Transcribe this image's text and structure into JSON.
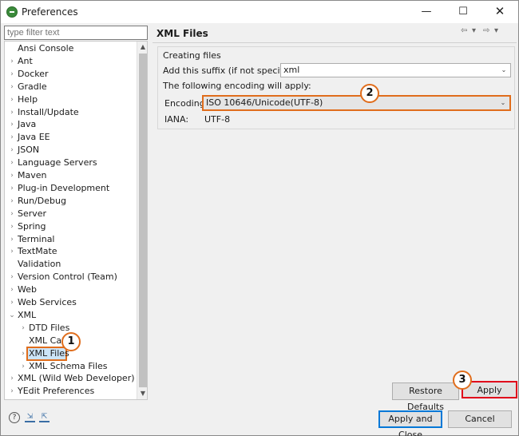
{
  "window": {
    "title": "Preferences",
    "minimize": "—",
    "maximize": "☐",
    "close": "✕"
  },
  "filter": {
    "placeholder": "type filter text"
  },
  "tree": {
    "items": [
      {
        "label": "Ansi Console",
        "arrow": ""
      },
      {
        "label": "Ant",
        "arrow": "›"
      },
      {
        "label": "Docker",
        "arrow": "›"
      },
      {
        "label": "Gradle",
        "arrow": "›"
      },
      {
        "label": "Help",
        "arrow": "›"
      },
      {
        "label": "Install/Update",
        "arrow": "›"
      },
      {
        "label": "Java",
        "arrow": "›"
      },
      {
        "label": "Java EE",
        "arrow": "›"
      },
      {
        "label": "JSON",
        "arrow": "›"
      },
      {
        "label": "Language Servers",
        "arrow": "›"
      },
      {
        "label": "Maven",
        "arrow": "›"
      },
      {
        "label": "Plug-in Development",
        "arrow": "›"
      },
      {
        "label": "Run/Debug",
        "arrow": "›"
      },
      {
        "label": "Server",
        "arrow": "›"
      },
      {
        "label": "Spring",
        "arrow": "›"
      },
      {
        "label": "Terminal",
        "arrow": "›"
      },
      {
        "label": "TextMate",
        "arrow": "›"
      },
      {
        "label": "Validation",
        "arrow": ""
      },
      {
        "label": "Version Control (Team)",
        "arrow": "›"
      },
      {
        "label": "Web",
        "arrow": "›"
      },
      {
        "label": "Web Services",
        "arrow": "›"
      },
      {
        "label": "XML",
        "arrow": "⌄"
      },
      {
        "label": "DTD Files",
        "arrow": "›"
      },
      {
        "label": "XML Cata",
        "arrow": ""
      },
      {
        "label": "XML Files",
        "arrow": "›"
      },
      {
        "label": "XML Schema Files",
        "arrow": "›"
      },
      {
        "label": "XML (Wild Web Developer)",
        "arrow": "›"
      },
      {
        "label": "YEdit Preferences",
        "arrow": "›"
      }
    ],
    "scroll_up": "▲",
    "scroll_down": "▼"
  },
  "callouts": [
    "1",
    "2",
    "3"
  ],
  "page": {
    "title": "XML Files",
    "nav": {
      "back": "⇦",
      "back_menu": "▾",
      "forward": "⇨",
      "forward_menu": "▾"
    },
    "group_title": "Creating files",
    "suffix_label": "Add this suffix (if not specified):",
    "suffix_value": "xml",
    "encoding_note": "The following encoding will apply:",
    "encoding_label": "Encoding:",
    "encoding_value": "ISO 10646/Unicode(UTF-8)",
    "iana_label": "IANA:",
    "iana_value": "UTF-8",
    "combo_arrow": "⌄"
  },
  "buttons": {
    "restore_defaults": "Restore Defaults",
    "apply": "Apply",
    "apply_and_close": "Apply and Close",
    "cancel": "Cancel"
  },
  "bottom": {
    "help": "?",
    "import": "⇲",
    "export": "⇱"
  },
  "colors": {
    "highlight": "#e06d1c",
    "apply_highlight": "#e0001b",
    "selection": "#cce4f7",
    "default_button": "#0078d7"
  }
}
